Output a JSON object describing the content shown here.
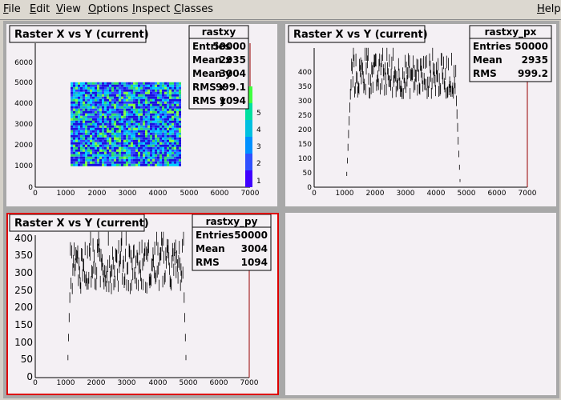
{
  "menu": [
    {
      "id": "file",
      "ul": "F",
      "rest": "ile"
    },
    {
      "id": "edit",
      "ul": "E",
      "rest": "dit"
    },
    {
      "id": "view",
      "ul": "V",
      "rest": "iew"
    },
    {
      "id": "options",
      "ul": "O",
      "rest": "ptions"
    },
    {
      "id": "inspect",
      "ul": "I",
      "rest": "nspect"
    },
    {
      "id": "classes",
      "ul": "C",
      "rest": "lasses"
    },
    {
      "id": "help",
      "ul": "H",
      "rest": "elp"
    }
  ],
  "pads": {
    "p1": {
      "title": "Raster X vs Y (current)",
      "stats": {
        "name": "rastxy",
        "rows": [
          {
            "label": "Entries",
            "value": "50000"
          },
          {
            "label": "Mean x",
            "value": "2935"
          },
          {
            "label": "Mean y",
            "value": "3004"
          },
          {
            "label": "RMS x",
            "value": "999.1"
          },
          {
            "label": "RMS y",
            "value": "1094"
          }
        ]
      },
      "xticks": [
        "0",
        "1000",
        "2000",
        "3000",
        "4000",
        "5000",
        "6000",
        "7000"
      ],
      "yticks": [
        "0",
        "1000",
        "2000",
        "3000",
        "4000",
        "5000",
        "6000"
      ],
      "palette_ticks": [
        "1",
        "2",
        "3",
        "4",
        "5"
      ]
    },
    "p2": {
      "title": "Raster X vs Y (current)",
      "stats": {
        "name": "rastxy_px",
        "rows": [
          {
            "label": "Entries",
            "value": "50000"
          },
          {
            "label": "Mean",
            "value": "2935"
          },
          {
            "label": "RMS",
            "value": "999.2"
          }
        ]
      },
      "xticks": [
        "0",
        "1000",
        "2000",
        "3000",
        "4000",
        "5000",
        "6000",
        "7000"
      ],
      "yticks": [
        "0",
        "50",
        "100",
        "150",
        "200",
        "250",
        "300",
        "350",
        "400"
      ]
    },
    "p3": {
      "title": "Raster X vs Y (current)",
      "stats": {
        "name": "rastxy_py",
        "rows": [
          {
            "label": "Entries",
            "value": "50000"
          },
          {
            "label": "Mean",
            "value": "3004"
          },
          {
            "label": "RMS",
            "value": "1094"
          }
        ]
      },
      "xticks": [
        "0",
        "1000",
        "2000",
        "3000",
        "4000",
        "5000",
        "6000",
        "7000"
      ],
      "yticks": [
        "0",
        "50",
        "100",
        "150",
        "200",
        "250",
        "300",
        "350",
        "400"
      ]
    }
  },
  "chart_data": [
    {
      "type": "heatmap",
      "title": "Raster X vs Y (current)",
      "xlim": [
        0,
        7000
      ],
      "ylim": [
        0,
        6500
      ],
      "filled_region": {
        "x": [
          1150,
          4750
        ],
        "y": [
          1050,
          4900
        ]
      },
      "z_range": [
        0,
        6
      ]
    },
    {
      "type": "bar",
      "title": "Raster X vs Y (current)",
      "xlim": [
        0,
        7000
      ],
      "ylim": [
        0,
        440
      ],
      "plateau": {
        "x": [
          1200,
          4650
        ],
        "y_typical": 350,
        "y_peak": 420
      },
      "edges": [
        1050,
        1200,
        4650,
        4800
      ]
    },
    {
      "type": "bar",
      "title": "Raster X vs Y (current)",
      "xlim": [
        0,
        7000
      ],
      "ylim": [
        0,
        410
      ],
      "plateau": {
        "x": [
          1150,
          4850
        ],
        "y_typical": 320,
        "y_peak": 400
      },
      "edges": [
        1050,
        1150,
        4850,
        4950
      ]
    }
  ]
}
